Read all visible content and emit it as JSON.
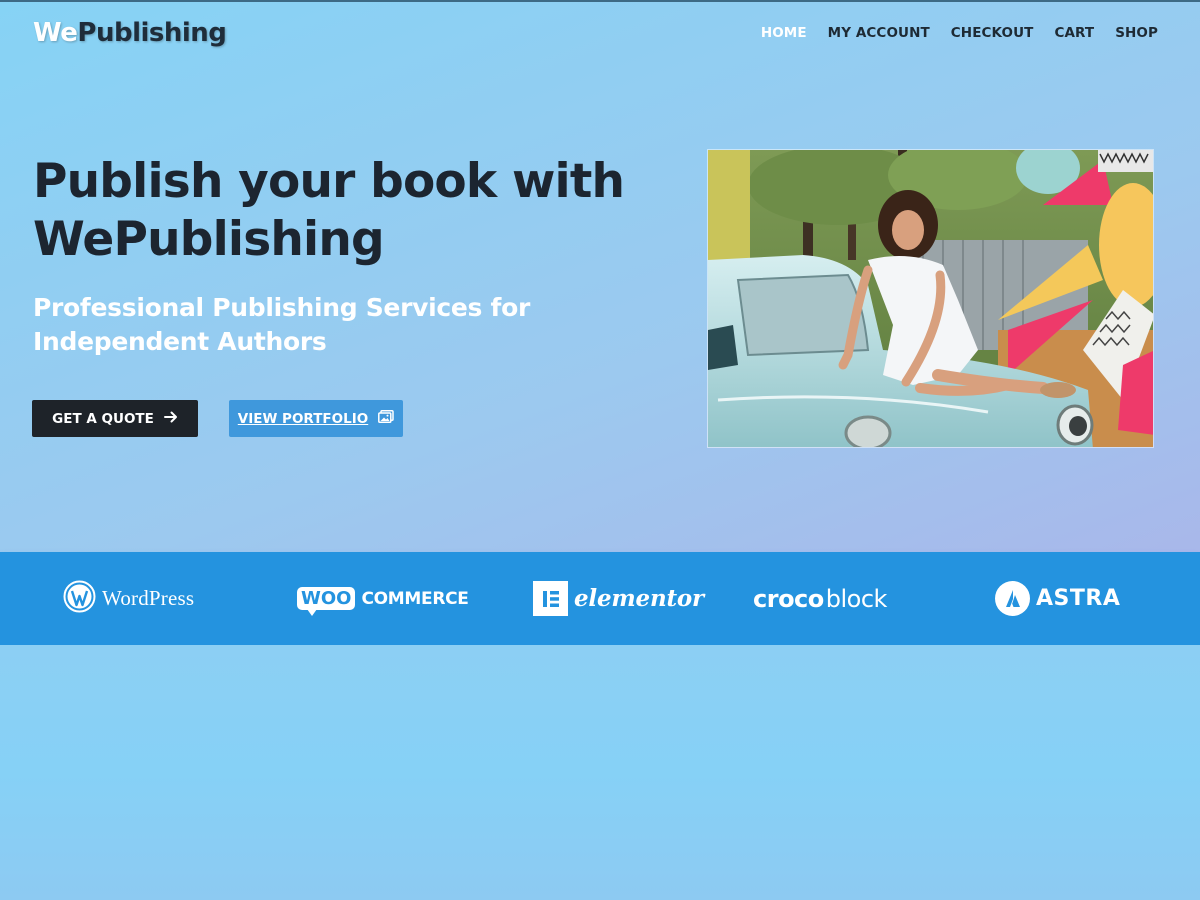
{
  "header": {
    "logo_part1": "We",
    "logo_part2": "Publishing",
    "nav": [
      "HOME",
      "MY ACCOUNT",
      "CHECKOUT",
      "CART",
      "SHOP"
    ],
    "active_nav": "HOME"
  },
  "hero": {
    "title_line1": "Publish your book with",
    "title_line2": "WePublishing",
    "subtitle_line1": "Professional Publishing Services for",
    "subtitle_line2": "Independent Authors",
    "primary_button": "GET A QUOTE",
    "primary_icon": "arrow-right-icon",
    "secondary_button": "VIEW PORTFOLIO",
    "secondary_icon": "image-icon",
    "photo": "woman-in-white-dress-on-vintage-car-photo"
  },
  "partners": {
    "wordpress": "WordPress",
    "woo_badge": "WOO",
    "woo_text": "COMMERCE",
    "elementor": "elementor",
    "croco": "croco",
    "block": "block",
    "astra": "ASTRA"
  },
  "colors": {
    "band": "#2493df",
    "primary_button": "#1e2329",
    "secondary_button": "#3f98dc",
    "title_text": "#1c2530"
  }
}
